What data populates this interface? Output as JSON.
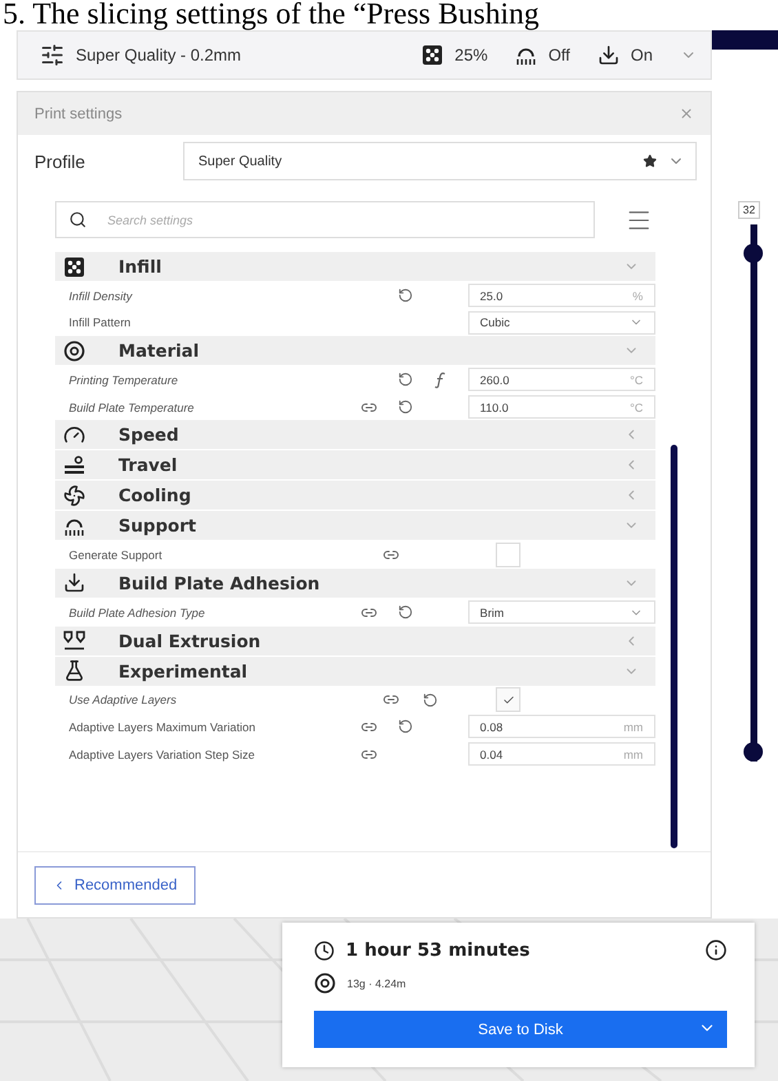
{
  "caption": "5. The slicing settings of the “Press Bushing",
  "toolbar": {
    "profile": "Super Quality - 0.2mm",
    "infill": "25%",
    "support": "Off",
    "adhesion": "On"
  },
  "print_settings": {
    "title": "Print settings",
    "profile_label": "Profile",
    "profile_value": "Super Quality",
    "search_placeholder": "Search settings",
    "categories": [
      {
        "name": "Infill",
        "expanded": true,
        "settings": [
          {
            "label": "Infill Density",
            "kind": "number",
            "modified": true,
            "linked": false,
            "reset": true,
            "formula": false,
            "value": "25.0",
            "unit": "%"
          },
          {
            "label": "Infill Pattern",
            "kind": "select",
            "modified": false,
            "linked": false,
            "reset": false,
            "formula": false,
            "value": "Cubic"
          }
        ]
      },
      {
        "name": "Material",
        "expanded": true,
        "settings": [
          {
            "label": "Printing Temperature",
            "kind": "number",
            "modified": true,
            "linked": false,
            "reset": true,
            "formula": true,
            "value": "260.0",
            "unit": "°C"
          },
          {
            "label": "Build Plate Temperature",
            "kind": "number",
            "modified": true,
            "linked": true,
            "reset": true,
            "formula": false,
            "value": "110.0",
            "unit": "°C"
          }
        ]
      },
      {
        "name": "Speed",
        "expanded": false
      },
      {
        "name": "Travel",
        "expanded": false
      },
      {
        "name": "Cooling",
        "expanded": false
      },
      {
        "name": "Support",
        "expanded": true,
        "settings": [
          {
            "label": "Generate Support",
            "kind": "checkbox",
            "modified": false,
            "linked": true,
            "reset": false,
            "formula": false,
            "checked": false
          }
        ]
      },
      {
        "name": "Build Plate Adhesion",
        "expanded": true,
        "settings": [
          {
            "label": "Build Plate Adhesion Type",
            "kind": "select",
            "modified": true,
            "linked": true,
            "reset": true,
            "formula": false,
            "value": "Brim"
          }
        ]
      },
      {
        "name": "Dual Extrusion",
        "expanded": false
      },
      {
        "name": "Experimental",
        "expanded": true,
        "settings": [
          {
            "label": "Use Adaptive Layers",
            "kind": "checkbox",
            "modified": true,
            "linked": true,
            "reset": true,
            "formula": false,
            "checked": true
          },
          {
            "label": "Adaptive Layers Maximum Variation",
            "kind": "number",
            "modified": false,
            "linked": true,
            "reset": true,
            "formula": false,
            "value": "0.08",
            "unit": "mm"
          },
          {
            "label": "Adaptive Layers Variation Step Size",
            "kind": "number",
            "modified": false,
            "linked": true,
            "reset": false,
            "formula": false,
            "value": "0.04",
            "unit": "mm"
          }
        ]
      }
    ],
    "recommended_button": "Recommended"
  },
  "layer_slider": {
    "top_label": "32",
    "level": 1
  },
  "print_summary": {
    "time": "1 hour 53 minutes",
    "material": "13g · 4.24m",
    "button": "Save to Disk"
  }
}
